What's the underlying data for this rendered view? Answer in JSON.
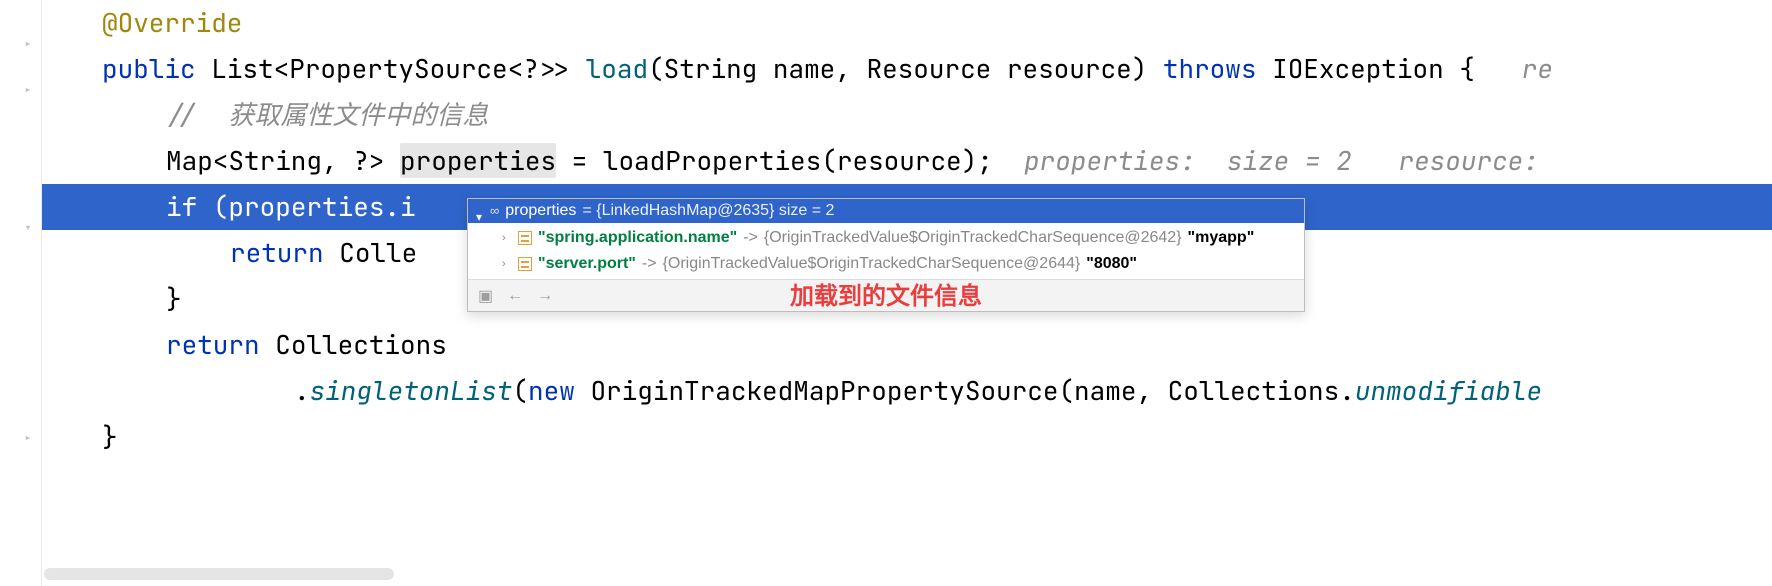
{
  "code": {
    "annotation": "@Override",
    "kw_public": "public",
    "type_list": "List",
    "type_prop_src": "PropertySource",
    "type_wild": "<?>>",
    "method_load": "load",
    "sig_rest": "(String name, Resource resource)",
    "kw_throws": "throws",
    "type_ioex": "IOException {",
    "hint_re": "re",
    "comment_get": "//  获取属性文件中的信息",
    "type_map": "Map<String, ?>",
    "var_properties": "properties",
    "eq": " = ",
    "call_loadprops": "loadProperties(resource);",
    "hint_props": "properties:  size = 2",
    "hint_res": "resource:",
    "if_stmt": "if (properties.i",
    "ret_colle": "return Colle",
    "brace_close1": "}",
    "ret_collections": "return Collections",
    "dot": ".",
    "singleton_call": "singletonList",
    "paren_open": "(",
    "kw_new": "new",
    "ctor_origin": " OriginTrackedMapPropertySource(name, Collections.",
    "unmod": "unmodifiable",
    "brace_close2": "}"
  },
  "popup": {
    "header_var": "properties",
    "header_type": " = {LinkedHashMap@2635}  size = 2",
    "rows": [
      {
        "key": "\"spring.application.name\"",
        "arrow": " -> ",
        "type": "{OriginTrackedValue$OriginTrackedCharSequence@2642}",
        "value": " \"myapp\""
      },
      {
        "key": "\"server.port\"",
        "arrow": " -> ",
        "type": "{OriginTrackedValue$OriginTrackedCharSequence@2644}",
        "value": " \"8080\""
      }
    ],
    "annotation": "加载到的文件信息"
  }
}
